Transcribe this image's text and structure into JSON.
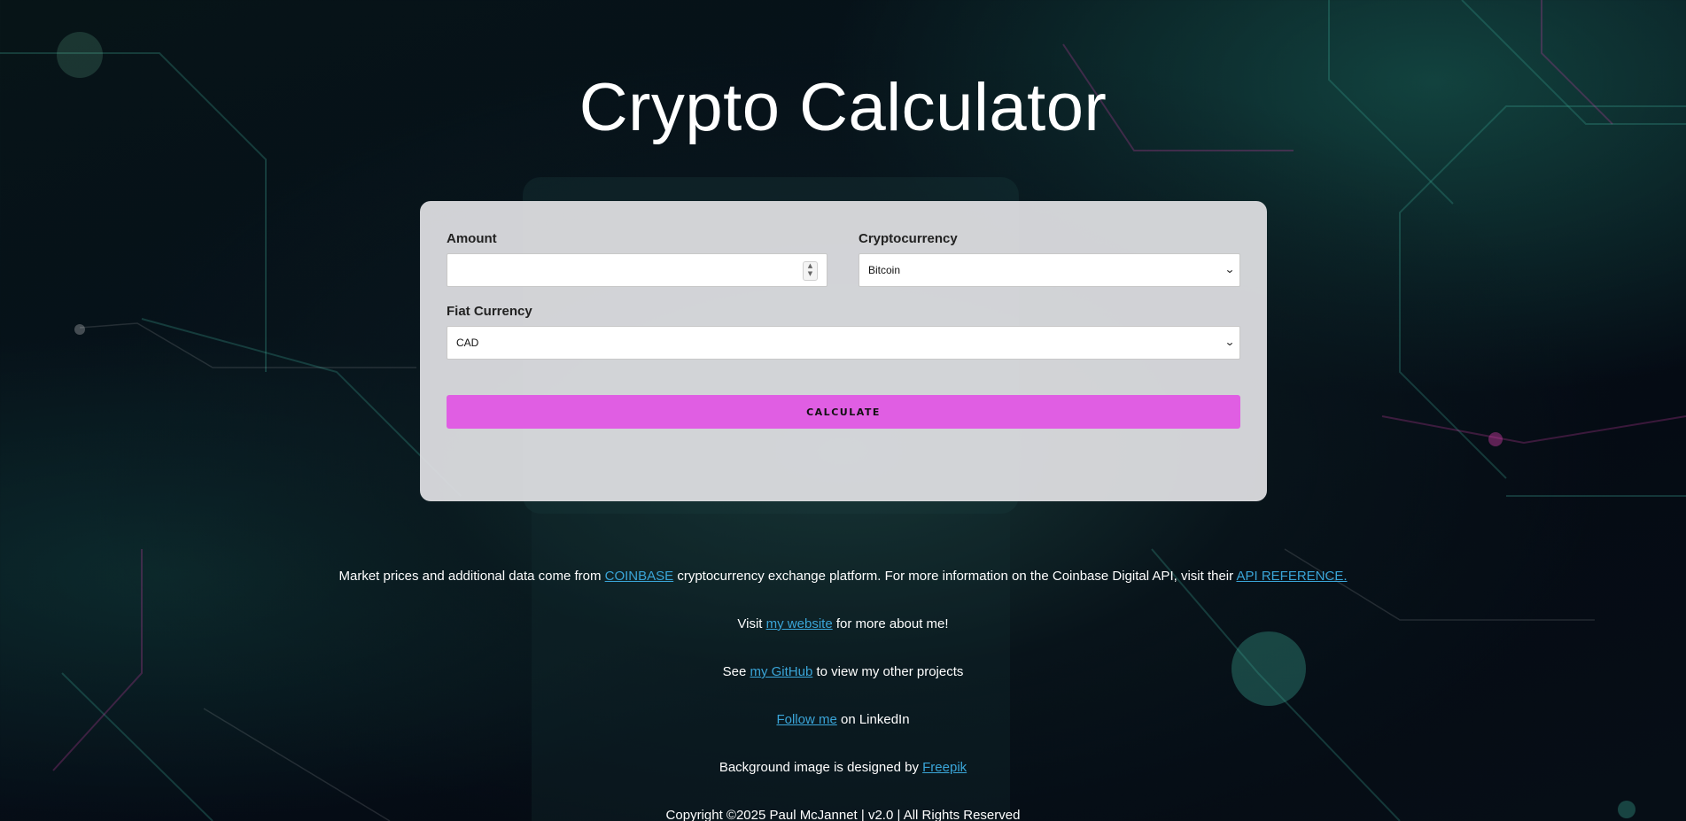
{
  "header": {
    "title": "Crypto Calculator"
  },
  "form": {
    "amount_label": "Amount",
    "amount_value": "",
    "crypto_label": "Cryptocurrency",
    "crypto_selected": "Bitcoin",
    "fiat_label": "Fiat Currency",
    "fiat_selected": "CAD",
    "calculate_label": "CALCULATE"
  },
  "footer": {
    "data_source": {
      "before": "Market prices and additional data come from ",
      "link1": "COINBASE",
      "middle": " cryptocurrency exchange platform. For more information on the Coinbase Digital API, visit their ",
      "link2": "API REFERENCE."
    },
    "website": {
      "before": "Visit ",
      "link": "my website",
      "after": " for more about me!"
    },
    "github": {
      "before": "See ",
      "link": "my GitHub",
      "after": " to view my other projects"
    },
    "linkedin": {
      "link": "Follow me",
      "after": " on LinkedIn"
    },
    "credit": {
      "before": "Background image is designed by ",
      "link": "Freepik"
    },
    "copyright": "Copyright ©2025 Paul McJannet | v2.0 | All Rights Reserved"
  },
  "colors": {
    "accent": "#e05ee3",
    "link": "#3aa5d8",
    "card": "#e1e1e4"
  },
  "icons": {
    "select_chevron": "chevron-down-icon",
    "number_spinner": "spinner-icon"
  }
}
